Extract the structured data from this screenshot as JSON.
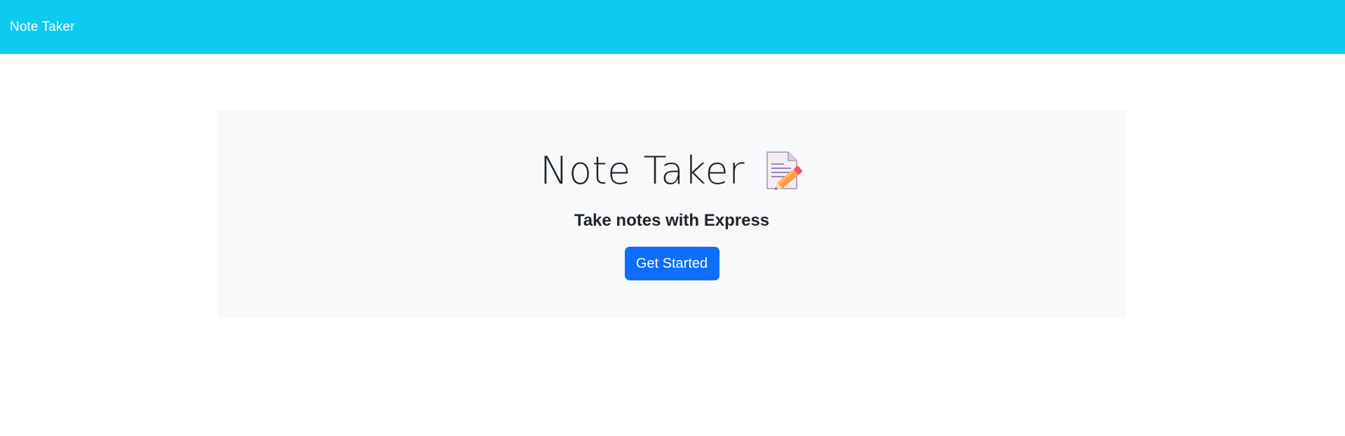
{
  "navbar": {
    "brand": "Note Taker"
  },
  "hero": {
    "title": "Note Taker",
    "icon": "memo-icon",
    "subtitle": "Take notes with Express",
    "button_label": "Get Started"
  },
  "colors": {
    "navbar_bg": "#0dcaf0",
    "hero_bg": "#f8f9fa",
    "button_bg": "#0d6efd"
  }
}
